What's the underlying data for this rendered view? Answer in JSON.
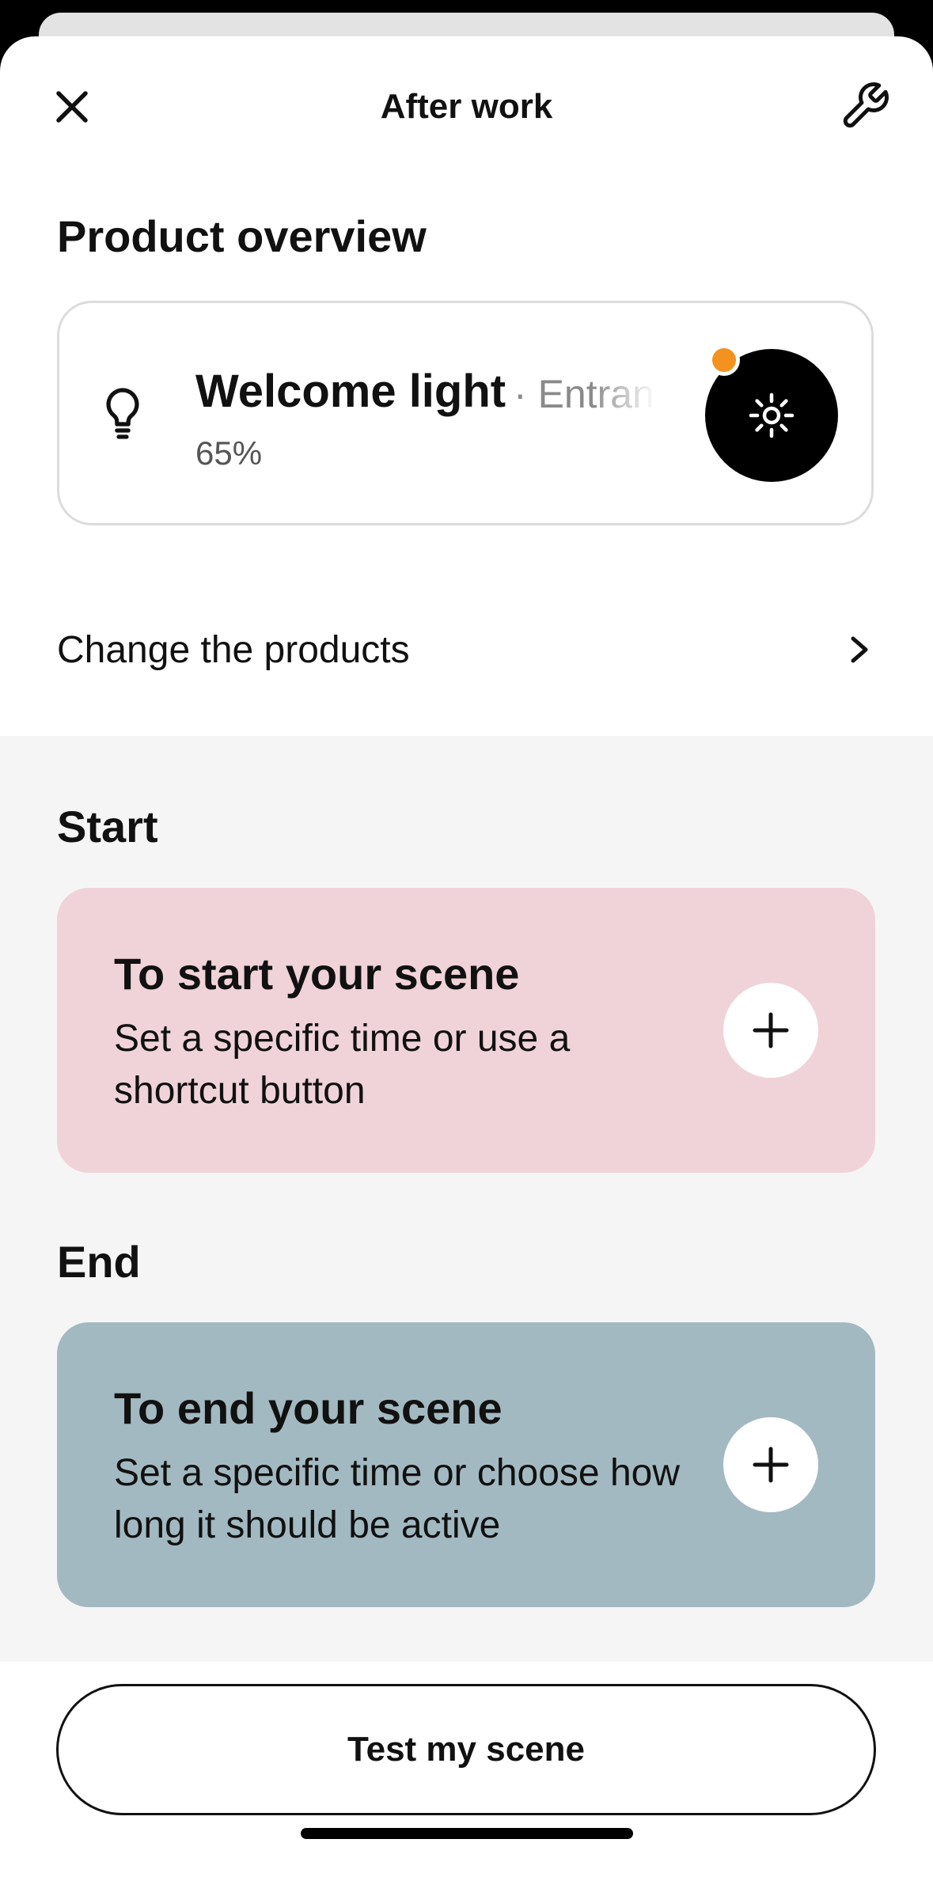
{
  "header": {
    "title": "After work",
    "close_icon": "close-icon",
    "settings_icon": "wrench-icon"
  },
  "product_overview": {
    "heading": "Product overview",
    "product": {
      "name": "Welcome light",
      "separator": "·",
      "room": "Entran",
      "level": "65%",
      "icon": "bulb-icon",
      "toggle_icon": "sun-icon",
      "status_color": "#f3921f"
    },
    "change_label": "Change the products"
  },
  "start": {
    "heading": "Start",
    "card_title": "To start your scene",
    "card_description": "Set a specific time or use a shortcut button",
    "card_color": "#f0d3d8"
  },
  "end": {
    "heading": "End",
    "card_title": "To end your scene",
    "card_description": "Set a specific time or choose how long it should be active",
    "card_color": "#a3b9c1"
  },
  "footer": {
    "test_button": "Test my scene"
  }
}
